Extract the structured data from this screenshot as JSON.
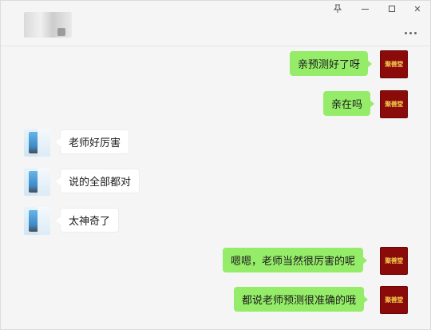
{
  "window": {
    "controls": [
      "pin-icon",
      "minimize-icon",
      "maximize-icon",
      "close-icon"
    ],
    "close_glyph": "✕",
    "pin_glyph": "⚲"
  },
  "header": {
    "more_icon": "more-dots-icon"
  },
  "avatars": {
    "self_text": "聚善堂",
    "self_color": "#8b0a0a",
    "self_text_color": "#f2c94c"
  },
  "messages": [
    {
      "side": "out",
      "text": "亲预测好了呀"
    },
    {
      "side": "out",
      "text": "亲在吗"
    },
    {
      "side": "in",
      "text": "老师好厉害"
    },
    {
      "side": "in",
      "text": "说的全部都对"
    },
    {
      "side": "in",
      "text": "太神奇了"
    },
    {
      "side": "out",
      "text": "嗯嗯，老师当然很厉害的呢"
    },
    {
      "side": "out",
      "text": "都说老师预测很准确的哦"
    }
  ],
  "colors": {
    "outgoing_bubble": "#95ec69",
    "incoming_bubble": "#ffffff",
    "background": "#f5f5f5"
  }
}
